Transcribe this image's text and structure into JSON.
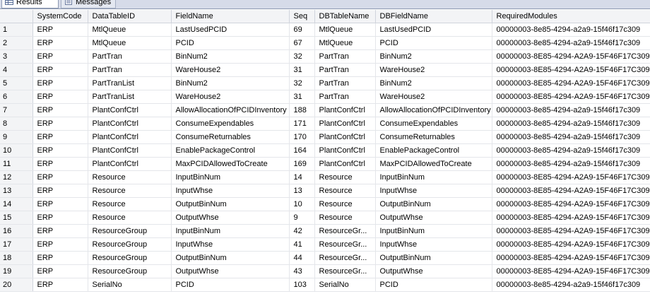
{
  "tabs": [
    {
      "label": "Results",
      "icon": "grid-icon"
    },
    {
      "label": "Messages",
      "icon": "document-icon"
    }
  ],
  "columns": [
    "",
    "SystemCode",
    "DataTableID",
    "FieldName",
    "Seq",
    "DBTableName",
    "DBFieldName",
    "RequiredModules"
  ],
  "rows": [
    [
      "1",
      "ERP",
      "MtlQueue",
      "LastUsedPCID",
      "69",
      "MtlQueue",
      "LastUsedPCID",
      "00000003-8e85-4294-a2a9-15f46f17c309"
    ],
    [
      "2",
      "ERP",
      "MtlQueue",
      "PCID",
      "67",
      "MtlQueue",
      "PCID",
      "00000003-8e85-4294-a2a9-15f46f17c309"
    ],
    [
      "3",
      "ERP",
      "PartTran",
      "BinNum2",
      "32",
      "PartTran",
      "BinNum2",
      "00000003-8E85-4294-A2A9-15F46F17C309"
    ],
    [
      "4",
      "ERP",
      "PartTran",
      "WareHouse2",
      "31",
      "PartTran",
      "WareHouse2",
      "00000003-8E85-4294-A2A9-15F46F17C309"
    ],
    [
      "5",
      "ERP",
      "PartTranList",
      "BinNum2",
      "32",
      "PartTran",
      "BinNum2",
      "00000003-8E85-4294-A2A9-15F46F17C309"
    ],
    [
      "6",
      "ERP",
      "PartTranList",
      "WareHouse2",
      "31",
      "PartTran",
      "WareHouse2",
      "00000003-8E85-4294-A2A9-15F46F17C309"
    ],
    [
      "7",
      "ERP",
      "PlantConfCtrl",
      "AllowAllocationOfPCIDInventory",
      "188",
      "PlantConfCtrl",
      "AllowAllocationOfPCIDInventory",
      "00000003-8e85-4294-a2a9-15f46f17c309"
    ],
    [
      "8",
      "ERP",
      "PlantConfCtrl",
      "ConsumeExpendables",
      "171",
      "PlantConfCtrl",
      "ConsumeExpendables",
      "00000003-8e85-4294-a2a9-15f46f17c309"
    ],
    [
      "9",
      "ERP",
      "PlantConfCtrl",
      "ConsumeReturnables",
      "170",
      "PlantConfCtrl",
      "ConsumeReturnables",
      "00000003-8e85-4294-a2a9-15f46f17c309"
    ],
    [
      "10",
      "ERP",
      "PlantConfCtrl",
      "EnablePackageControl",
      "164",
      "PlantConfCtrl",
      "EnablePackageControl",
      "00000003-8e85-4294-a2a9-15f46f17c309"
    ],
    [
      "11",
      "ERP",
      "PlantConfCtrl",
      "MaxPCIDAllowedToCreate",
      "169",
      "PlantConfCtrl",
      "MaxPCIDAllowedToCreate",
      "00000003-8e85-4294-a2a9-15f46f17c309"
    ],
    [
      "12",
      "ERP",
      "Resource",
      "InputBinNum",
      "14",
      "Resource",
      "InputBinNum",
      "00000003-8E85-4294-A2A9-15F46F17C309"
    ],
    [
      "13",
      "ERP",
      "Resource",
      "InputWhse",
      "13",
      "Resource",
      "InputWhse",
      "00000003-8E85-4294-A2A9-15F46F17C309"
    ],
    [
      "14",
      "ERP",
      "Resource",
      "OutputBinNum",
      "10",
      "Resource",
      "OutputBinNum",
      "00000003-8E85-4294-A2A9-15F46F17C309"
    ],
    [
      "15",
      "ERP",
      "Resource",
      "OutputWhse",
      "9",
      "Resource",
      "OutputWhse",
      "00000003-8E85-4294-A2A9-15F46F17C309"
    ],
    [
      "16",
      "ERP",
      "ResourceGroup",
      "InputBinNum",
      "42",
      "ResourceGr...",
      "InputBinNum",
      "00000003-8E85-4294-A2A9-15F46F17C309"
    ],
    [
      "17",
      "ERP",
      "ResourceGroup",
      "InputWhse",
      "41",
      "ResourceGr...",
      "InputWhse",
      "00000003-8E85-4294-A2A9-15F46F17C309"
    ],
    [
      "18",
      "ERP",
      "ResourceGroup",
      "OutputBinNum",
      "44",
      "ResourceGr...",
      "OutputBinNum",
      "00000003-8E85-4294-A2A9-15F46F17C309"
    ],
    [
      "19",
      "ERP",
      "ResourceGroup",
      "OutputWhse",
      "43",
      "ResourceGr...",
      "OutputWhse",
      "00000003-8E85-4294-A2A9-15F46F17C309"
    ],
    [
      "20",
      "ERP",
      "SerialNo",
      "PCID",
      "103",
      "SerialNo",
      "PCID",
      "00000003-8e85-4294-a2a9-15f46f17c309"
    ]
  ]
}
